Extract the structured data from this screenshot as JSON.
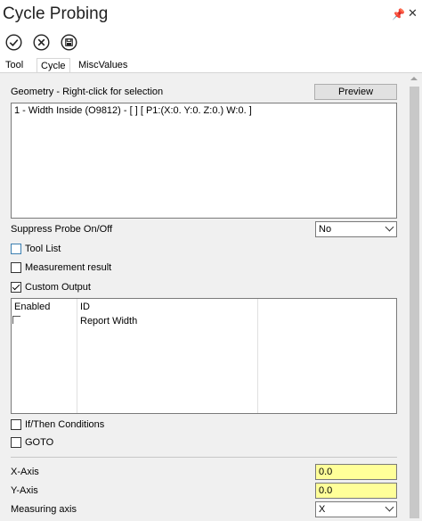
{
  "window": {
    "title": "Cycle Probing"
  },
  "tabs": [
    {
      "label": "Tool"
    },
    {
      "label": "Cycle"
    },
    {
      "label": "MiscValues"
    }
  ],
  "geometry": {
    "label": "Geometry - Right-click for selection",
    "preview_label": "Preview",
    "items": [
      "1 - Width Inside (O9812) - [  ] [ P1:(X:0. Y:0. Z:0.) W:0. ]"
    ]
  },
  "suppress_probe": {
    "label": "Suppress Probe On/Off",
    "value": "No"
  },
  "checkboxes": {
    "tool_list": {
      "label": "Tool List",
      "checked": false
    },
    "measurement_result": {
      "label": "Measurement result",
      "checked": false
    },
    "custom_output": {
      "label": "Custom Output",
      "checked": true
    },
    "if_then": {
      "label": "If/Then Conditions",
      "checked": false
    },
    "goto": {
      "label": "GOTO",
      "checked": false
    }
  },
  "custom_table": {
    "headers": [
      "Enabled",
      "ID"
    ],
    "rows": [
      {
        "enabled": false,
        "id": "Report Width"
      }
    ]
  },
  "fields": {
    "x_axis": {
      "label": "X-Axis",
      "value": "0.0"
    },
    "y_axis": {
      "label": "Y-Axis",
      "value": "0.0"
    },
    "measuring_axis": {
      "label": "Measuring axis",
      "value": "X"
    }
  },
  "colors": {
    "highlight_field": "#ffff99",
    "panel_bg": "#f0f0f0"
  }
}
